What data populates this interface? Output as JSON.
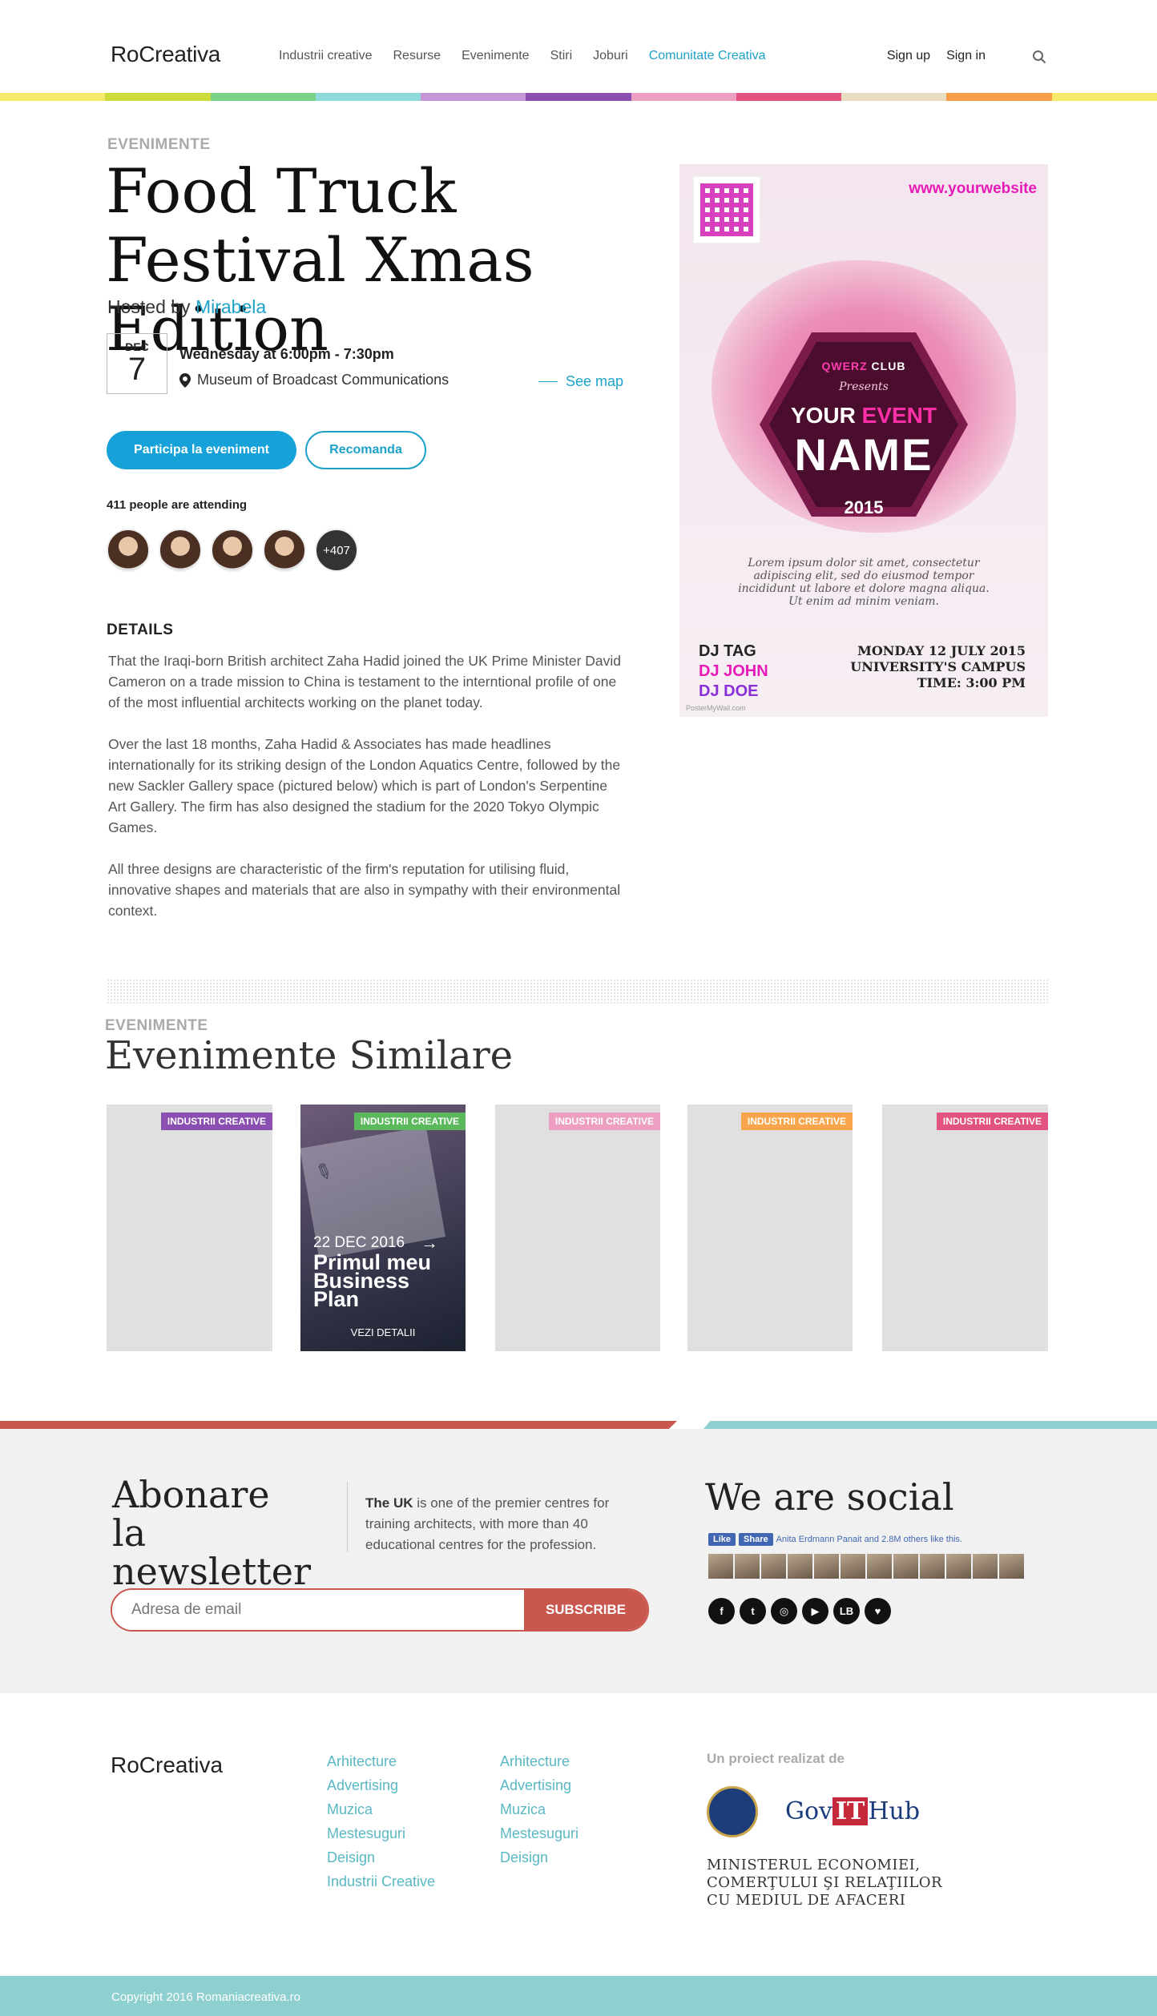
{
  "header": {
    "logo": "RoCreativa",
    "nav": [
      "Industrii creative",
      "Resurse",
      "Evenimente",
      "Stiri",
      "Joburi",
      "Comunitate Creativa"
    ],
    "signup": "Sign up",
    "signin": "Sign in",
    "search_icon": "search-icon"
  },
  "colorbar": [
    "#f7ea6a",
    "#cddc3a",
    "#7bd287",
    "#8edadb",
    "#c496d6",
    "#8a4fb0",
    "#ec9fc0",
    "#e2547f",
    "#e9ddc1",
    "#f89d47",
    "#f7ea6a"
  ],
  "event": {
    "kicker": "EVENIMENTE",
    "title": "Food Truck Festival Xmas Edition",
    "hosted_prefix": "Hosted by",
    "host": "Mirabela",
    "month": "DEC",
    "day": "7",
    "when": "Wednesday at 6:00pm - 7:30pm",
    "where": "Museum of Broadcast Communications",
    "see_map": "See map",
    "join_button": "Participa la eveniment",
    "recommend_button": "Recomanda",
    "attending": "411 people are attending",
    "more_count": "+407",
    "details_heading": "DETAILS",
    "details": [
      "That the Iraqi-born British architect Zaha Hadid joined the UK Prime Minister David Cameron on a trade mission to China is testament to the interntional profile of one of the most influential architects working on the planet today.",
      "Over the last 18 months, Zaha Hadid & Associates has made headlines internationally for its striking design of the London Aquatics Centre, followed by the new Sackler Gallery space (pictured below) which is part of London's Serpentine Art Gallery. The firm has also designed the stadium for the 2020 Tokyo Olympic Games.",
      "All three designs are characteristic of the firm's reputation for utilising fluid, innovative shapes and materials that are also in sympathy with their environmental context."
    ]
  },
  "poster": {
    "website": "www.yourwebsite",
    "club_a": "QWERZ",
    "club_b": "CLUB",
    "presents": "Presents",
    "your": "YOUR",
    "event_word": "EVENT",
    "name": "NAME",
    "year": "2015",
    "lorem": "Lorem ipsum dolor sit amet, consectetur adipiscing elit, sed do eiusmod tempor incididunt ut labore et dolore magna aliqua. Ut enim ad minim veniam.",
    "dj1": "DJ TAG",
    "dj2": "DJ JOHN",
    "dj3": "DJ DOE",
    "date": "MONDAY 12 JULY 2015",
    "venue": "UNIVERSITY'S CAMPUS",
    "time": "TIME: 3:00 PM",
    "credit": "PosterMyWall.com"
  },
  "similar": {
    "kicker": "EVENIMENTE",
    "title": "Evenimente Similare",
    "cards": [
      {
        "tag": "INDUSTRII CREATIVE",
        "color": "#8a4fb0"
      },
      {
        "tag": "INDUSTRII CREATIVE",
        "color": "#5cb85c",
        "date": "22 DEC 2016",
        "title": "Primul meu Business Plan",
        "more": "VEZI DETALII"
      },
      {
        "tag": "INDUSTRII CREATIVE",
        "color": "#ec9fc0"
      },
      {
        "tag": "INDUSTRII CREATIVE",
        "color": "#f8a54c"
      },
      {
        "tag": "INDUSTRII CREATIVE",
        "color": "#e2547f"
      }
    ]
  },
  "newsletter": {
    "title_line1": "Abonare",
    "title_line2": "la newsletter",
    "text_bold": "The UK",
    "text_rest": " is one of the premier centres for training architects, with more than 40 educational centres for the profession.",
    "placeholder": "Adresa de email",
    "button": "SUBSCRIBE"
  },
  "social": {
    "title": "We are social",
    "like": "Like",
    "share": "Share",
    "likes_text": "Anita Erdmann Panait and 2.8M others like this.",
    "icons": [
      "facebook-icon",
      "twitter-icon",
      "instagram-icon",
      "youtube-icon",
      "lb-icon",
      "heart-icon"
    ],
    "icon_glyphs": [
      "f",
      "t",
      "◎",
      "▶",
      "LB",
      "♥"
    ]
  },
  "footer": {
    "logo": "RoCreativa",
    "col1": [
      "Arhitecture",
      "Advertising",
      "Muzica",
      "Mestesuguri",
      "Deisign",
      "Industrii Creative"
    ],
    "col2": [
      "Arhitecture",
      "Advertising",
      "Muzica",
      "Mestesuguri",
      "Deisign"
    ],
    "project_label": "Un proiect realizat de",
    "govhub_a": "Gov",
    "govhub_b": "IT",
    "govhub_c": "Hub",
    "ministry": [
      "MINISTERUL ECONOMIEI,",
      "COMERŢULUI ŞI RELAŢIILOR",
      "CU MEDIUL DE AFACERI"
    ],
    "copyright": "Copyright 2016 Romaniacreativa.ro"
  }
}
